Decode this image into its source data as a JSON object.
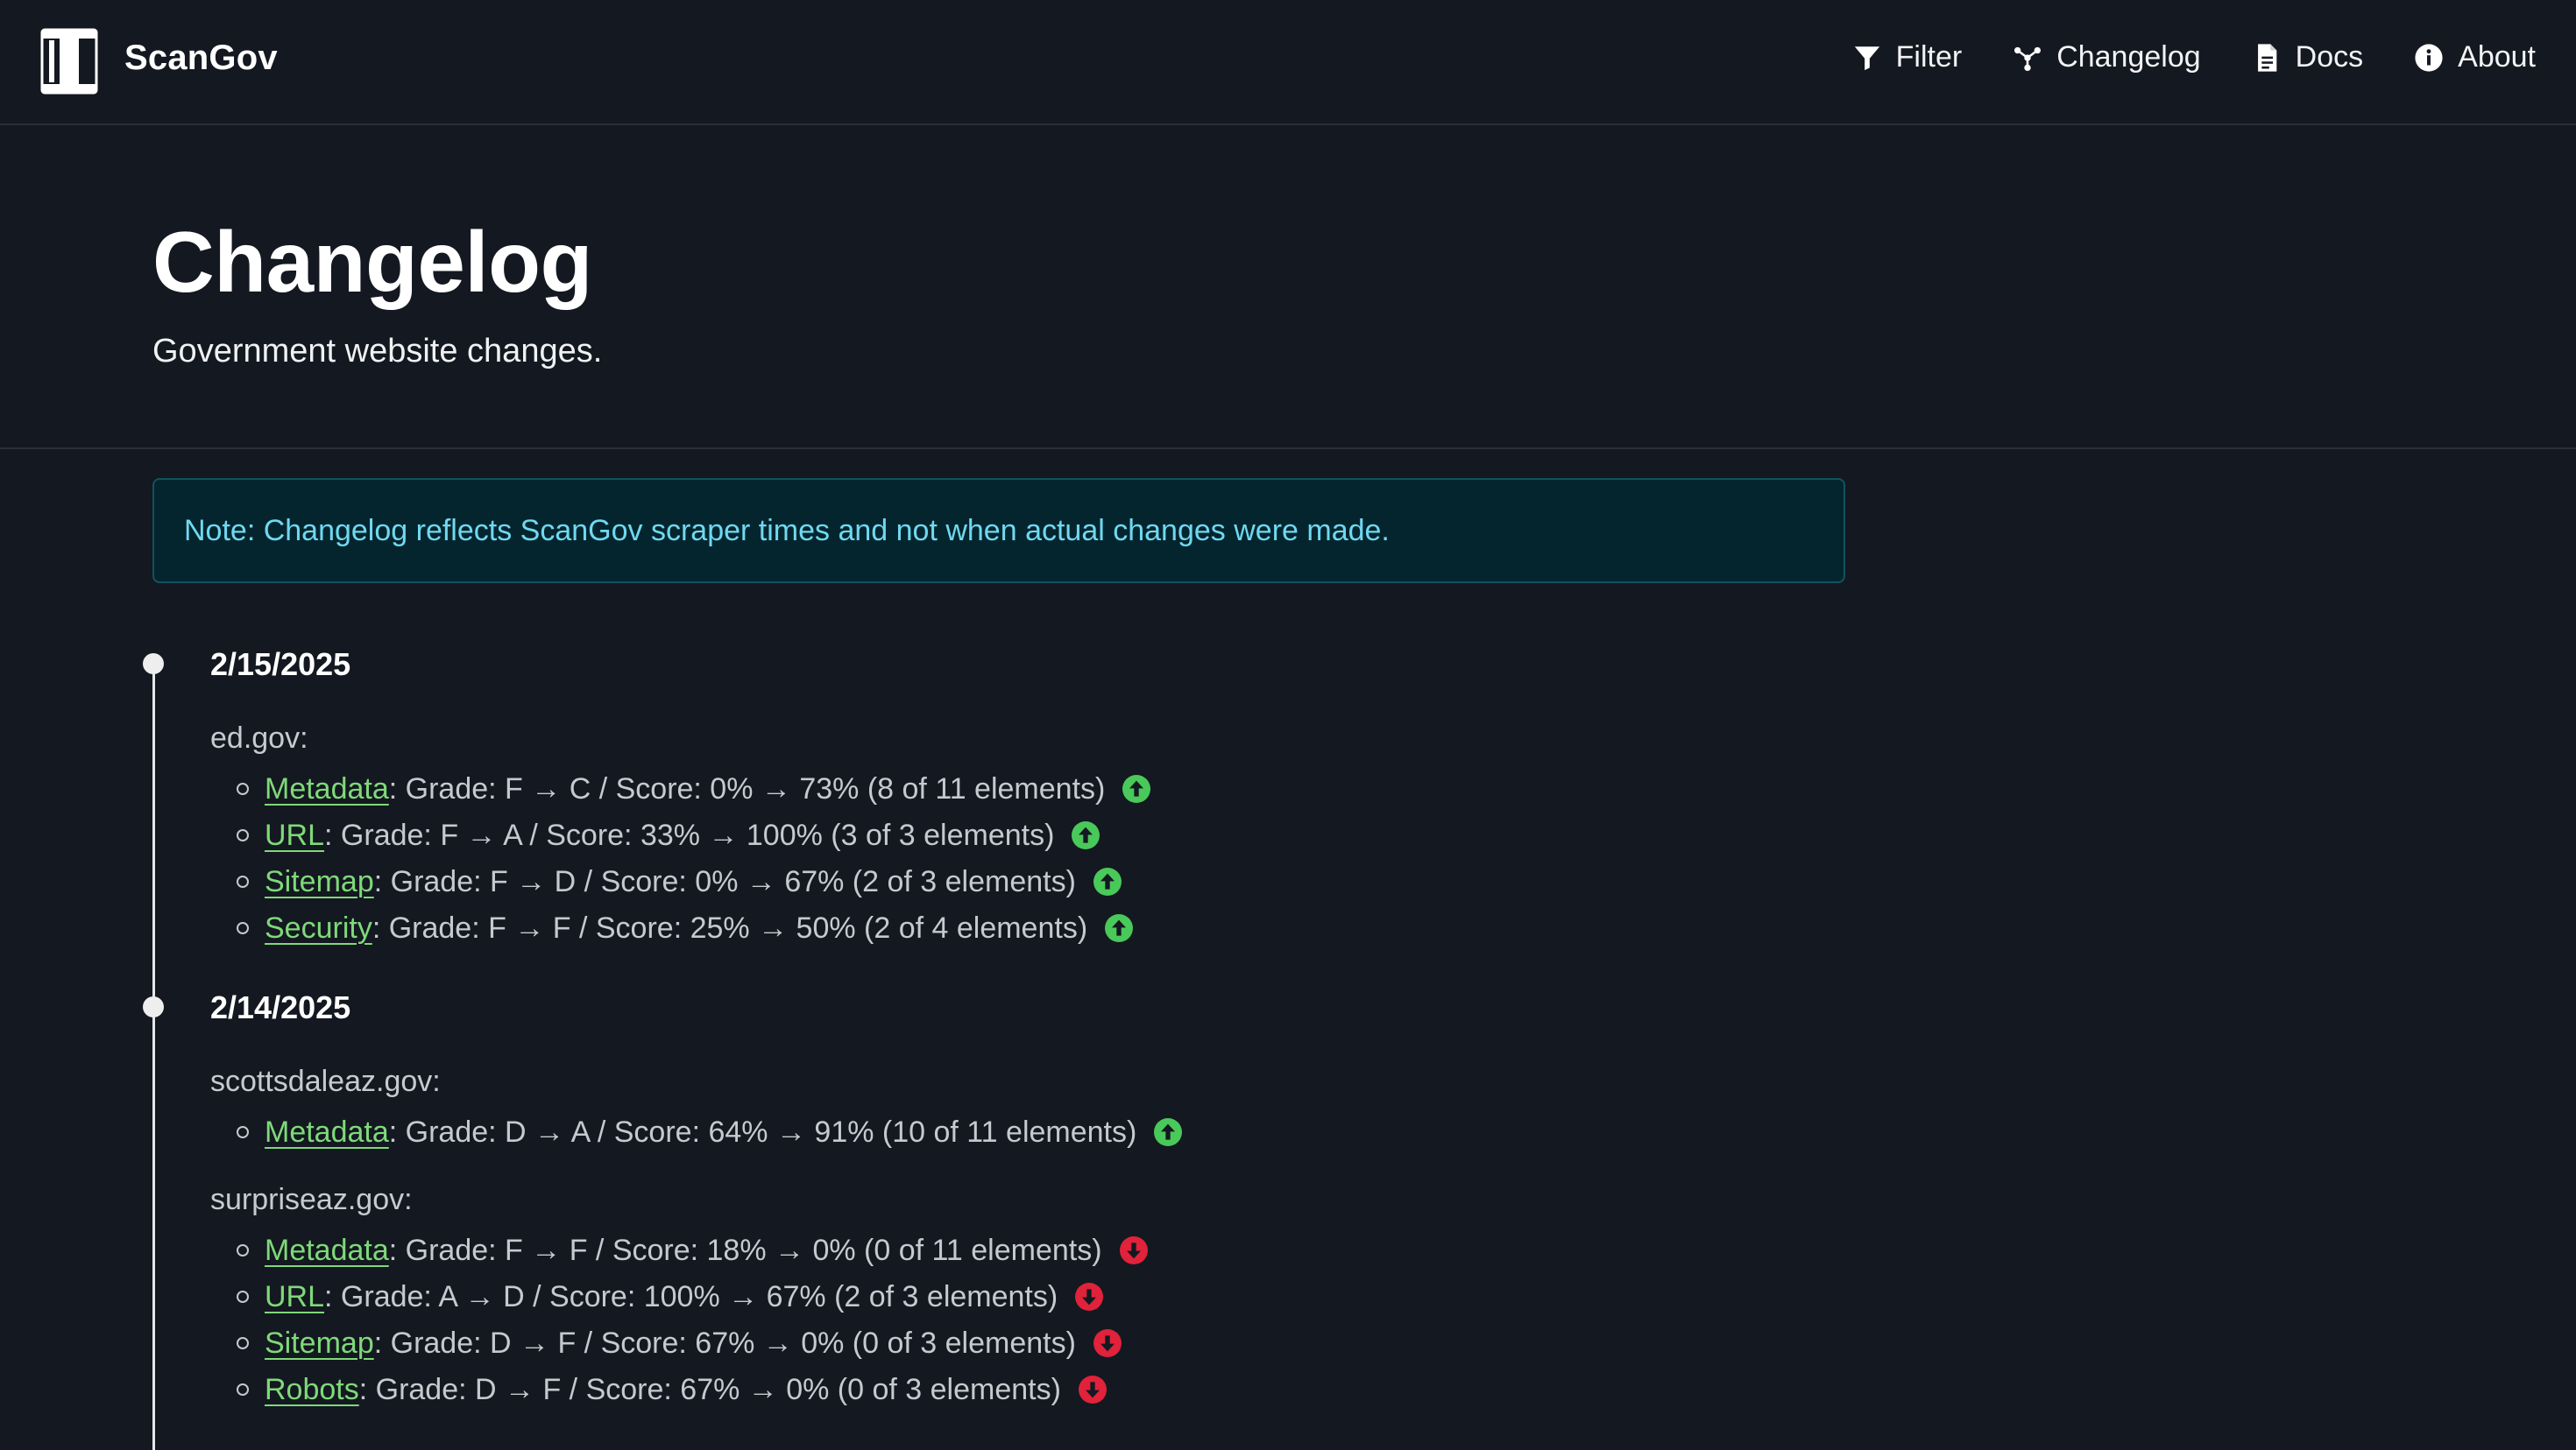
{
  "app": {
    "name": "ScanGov"
  },
  "nav": [
    {
      "label": "Filter",
      "icon": "filter-icon"
    },
    {
      "label": "Changelog",
      "icon": "changelog-icon"
    },
    {
      "label": "Docs",
      "icon": "document-icon"
    },
    {
      "label": "About",
      "icon": "info-icon"
    }
  ],
  "page": {
    "title": "Changelog",
    "subtitle": "Government website changes."
  },
  "note": {
    "text": "Note: Changelog reflects ScanGov scraper times and not when actual changes were made."
  },
  "colors": {
    "background": "#141820",
    "link": "#7fd97a",
    "up": "#49c95a",
    "down": "#e0223b",
    "note_bg": "#05252e",
    "note_text": "#6fd9f0"
  },
  "timeline": [
    {
      "date": "2/15/2025",
      "sites": [
        {
          "domain": "ed.gov:",
          "changes": [
            {
              "category": "Metadata",
              "detail": ": Grade: F → C / Score: 0% → 73% (8 of 11 elements)",
              "trend": "up"
            },
            {
              "category": "URL",
              "detail": ": Grade: F → A / Score: 33% → 100% (3 of 3 elements)",
              "trend": "up"
            },
            {
              "category": "Sitemap",
              "detail": ": Grade: F → D / Score: 0% → 67% (2 of 3 elements)",
              "trend": "up"
            },
            {
              "category": "Security",
              "detail": ": Grade: F → F / Score: 25% → 50% (2 of 4 elements)",
              "trend": "up"
            }
          ]
        }
      ]
    },
    {
      "date": "2/14/2025",
      "sites": [
        {
          "domain": "scottsdaleaz.gov:",
          "changes": [
            {
              "category": "Metadata",
              "detail": ": Grade: D → A / Score: 64% → 91% (10 of 11 elements)",
              "trend": "up"
            }
          ]
        },
        {
          "domain": "surpriseaz.gov:",
          "changes": [
            {
              "category": "Metadata",
              "detail": ": Grade: F → F / Score: 18% → 0% (0 of 11 elements)",
              "trend": "down"
            },
            {
              "category": "URL",
              "detail": ": Grade: A → D / Score: 100% → 67% (2 of 3 elements)",
              "trend": "down"
            },
            {
              "category": "Sitemap",
              "detail": ": Grade: D → F / Score: 67% → 0% (0 of 3 elements)",
              "trend": "down"
            },
            {
              "category": "Robots",
              "detail": ": Grade: D → F / Score: 67% → 0% (0 of 3 elements)",
              "trend": "down"
            }
          ]
        }
      ]
    }
  ]
}
